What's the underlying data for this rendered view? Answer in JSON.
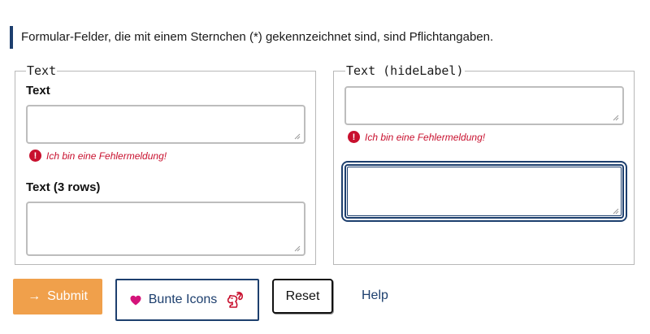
{
  "notice": "Formular-Felder, die mit einem Sternchen (*) gekennzeichnet sind, sind Pflichtangaben.",
  "left_group": {
    "legend": "Text",
    "field1_label": "Text",
    "field1_value": "",
    "field1_error": "Ich bin eine Fehlermeldung!",
    "field2_label": "Text (3 rows)",
    "field2_value": ""
  },
  "right_group": {
    "legend": "Text (hideLabel)",
    "field1_value": "",
    "field1_error": "Ich bin eine Fehlermeldung!",
    "field2_value": ""
  },
  "buttons": {
    "submit": "Submit",
    "bunte": "Bunte Icons",
    "reset": "Reset",
    "help": "Help"
  },
  "colors": {
    "primary": "#1d3f6e",
    "submit_bg": "#f0a04b",
    "error": "#c8102e",
    "heart": "#d4137a"
  },
  "icons": [
    "arrow-right-icon",
    "heart-icon",
    "squirrel-icon",
    "error-icon",
    "resize-grip-icon"
  ]
}
